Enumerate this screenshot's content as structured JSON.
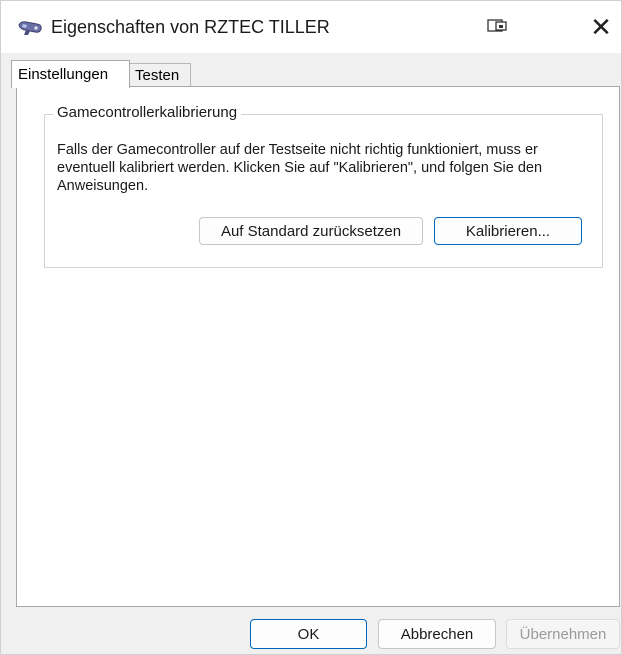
{
  "window": {
    "title": "Eigenschaften von RZTEC TILLER",
    "icons": {
      "app": "gamepad-icon",
      "restore": "restore-icon",
      "close": "close-icon"
    },
    "close_glyph": "✕"
  },
  "tabs": [
    {
      "label": "Einstellungen",
      "active": true
    },
    {
      "label": "Testen",
      "active": false
    }
  ],
  "calibration": {
    "group_title": "Gamecontrollerkalibrierung",
    "description": "Falls der Gamecontroller auf der Testseite nicht richtig funktioniert, muss er eventuell kalibriert werden. Klicken Sie auf \"Kalibrieren\", und folgen Sie den Anweisungen.",
    "reset_label": "Auf Standard zurücksetzen",
    "calibrate_label": "Kalibrieren..."
  },
  "footer": {
    "ok_label": "OK",
    "cancel_label": "Abbrechen",
    "apply_label": "Übernehmen"
  },
  "colors": {
    "accent": "#0067c0",
    "disabled_text": "#9b9b9b",
    "dialog_bg": "#f0f0f0"
  }
}
